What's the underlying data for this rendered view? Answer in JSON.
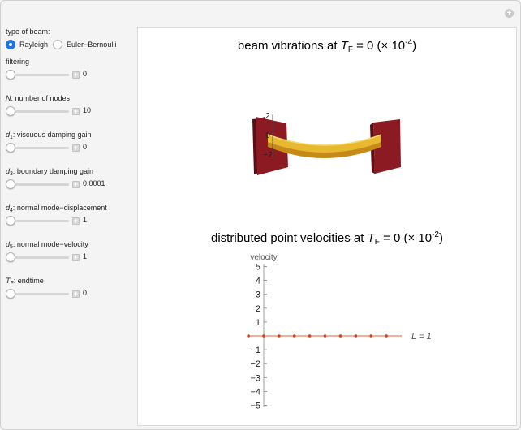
{
  "panel": {
    "beam_type_label": "type of beam:",
    "beam_options": [
      "Rayleigh",
      "Euler−Bernoulli"
    ],
    "selected_option": "Rayleigh",
    "sliders": [
      {
        "label": "filtering",
        "value": "0",
        "fraction": 0
      },
      {
        "label_symbol": "N",
        "label": ": number of nodes",
        "value": "10",
        "fraction": 0
      },
      {
        "label_symbol": "d",
        "label_sub": "1",
        "label": ": viscuous damping gain",
        "value": "0",
        "fraction": 0
      },
      {
        "label_symbol": "d",
        "label_sub": "3",
        "label": ": boundary damping gain",
        "value": "0.0001",
        "fraction": 0
      },
      {
        "label_symbol": "d",
        "label_sub": "4",
        "label": ": normal mode−displacement",
        "value": "1",
        "fraction": 0
      },
      {
        "label_symbol": "d",
        "label_sub": "5",
        "label": ": normal mode−velocity",
        "value": "1",
        "fraction": 0
      },
      {
        "label_symbol": "T",
        "label_sub": "F",
        "label": ": endtime",
        "value": "0",
        "fraction": 0
      }
    ]
  },
  "beam_plot": {
    "title_prefix": "beam vibrations at ",
    "title_symbol": "T",
    "title_sub": "F",
    "title_suffix": " = 0 (× 10",
    "title_exp": "-4",
    "title_close": ")",
    "axis_ticks": [
      "2",
      "0",
      "−2"
    ],
    "colors": {
      "wall": "#8b1a22",
      "beam": "#e8b830"
    }
  },
  "chart_data": {
    "type": "scatter",
    "title_prefix": "distributed point velocities at ",
    "title_symbol": "T",
    "title_sub": "F",
    "title_suffix": " = 0 (× 10",
    "title_exp": "-2",
    "title_close": ")",
    "ylabel": "velocity",
    "xlabel": "L = 1",
    "ylim": [
      -5,
      5
    ],
    "xlim": [
      -0.15,
      1
    ],
    "yticks": [
      "5",
      "4",
      "3",
      "2",
      "1",
      "−1",
      "−2",
      "−3",
      "−4",
      "−5"
    ],
    "series": [
      {
        "x": [
          -0.111,
          0,
          0.111,
          0.222,
          0.333,
          0.444,
          0.556,
          0.667,
          0.778,
          0.889
        ],
        "y": [
          0,
          0,
          0,
          0,
          0,
          0,
          0,
          0,
          0,
          0
        ]
      }
    ],
    "colors": {
      "points": "#d0401e",
      "line": "#e06040"
    }
  }
}
